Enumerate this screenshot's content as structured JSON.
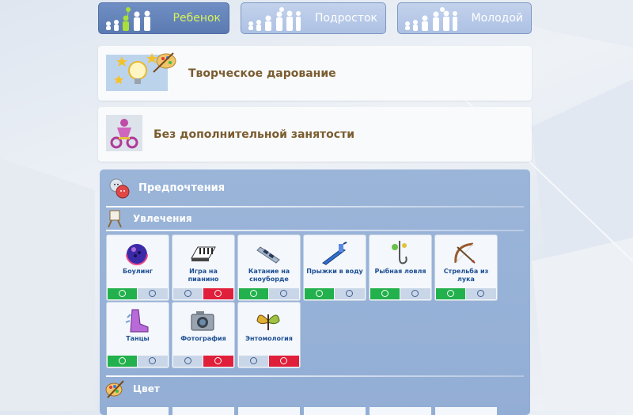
{
  "age_tabs": [
    {
      "label": "Ребенок",
      "active": true
    },
    {
      "label": "Подросток",
      "active": false
    },
    {
      "label": "Молодой",
      "active": false
    }
  ],
  "aspiration": {
    "title": "Творческое дарование",
    "icon": "lightbulb-palette-icon"
  },
  "occupation": {
    "title": "Без дополнительной занятости",
    "icon": "tricycle-icon"
  },
  "preferences": {
    "title": "Предпочтения",
    "hobbies": {
      "title": "Увлечения",
      "items": [
        {
          "name": "Боулинг",
          "icon": "bowling-ball-icon",
          "state": "like"
        },
        {
          "name": "Игра на пианино",
          "icon": "piano-keys-icon",
          "state": "dislike"
        },
        {
          "name": "Катание на сноуборде",
          "icon": "snowboard-icon",
          "state": "like"
        },
        {
          "name": "Прыжки в воду",
          "icon": "diving-board-icon",
          "state": "like"
        },
        {
          "name": "Рыбная ловля",
          "icon": "fishing-hook-icon",
          "state": "like"
        },
        {
          "name": "Стрельба из лука",
          "icon": "bow-arrow-icon",
          "state": "like"
        },
        {
          "name": "Танцы",
          "icon": "dance-shoe-icon",
          "state": "like"
        },
        {
          "name": "Фотография",
          "icon": "camera-icon",
          "state": "dislike"
        },
        {
          "name": "Энтомология",
          "icon": "butterfly-icon",
          "state": "dislike"
        }
      ]
    },
    "colors": {
      "title": "Цвет"
    }
  },
  "colors": {
    "active_tab_label": "#d8f25a",
    "like": "#22b14c",
    "dislike": "#e0203a",
    "item_text": "#1d4f94",
    "card_title": "#7a5c2f"
  }
}
